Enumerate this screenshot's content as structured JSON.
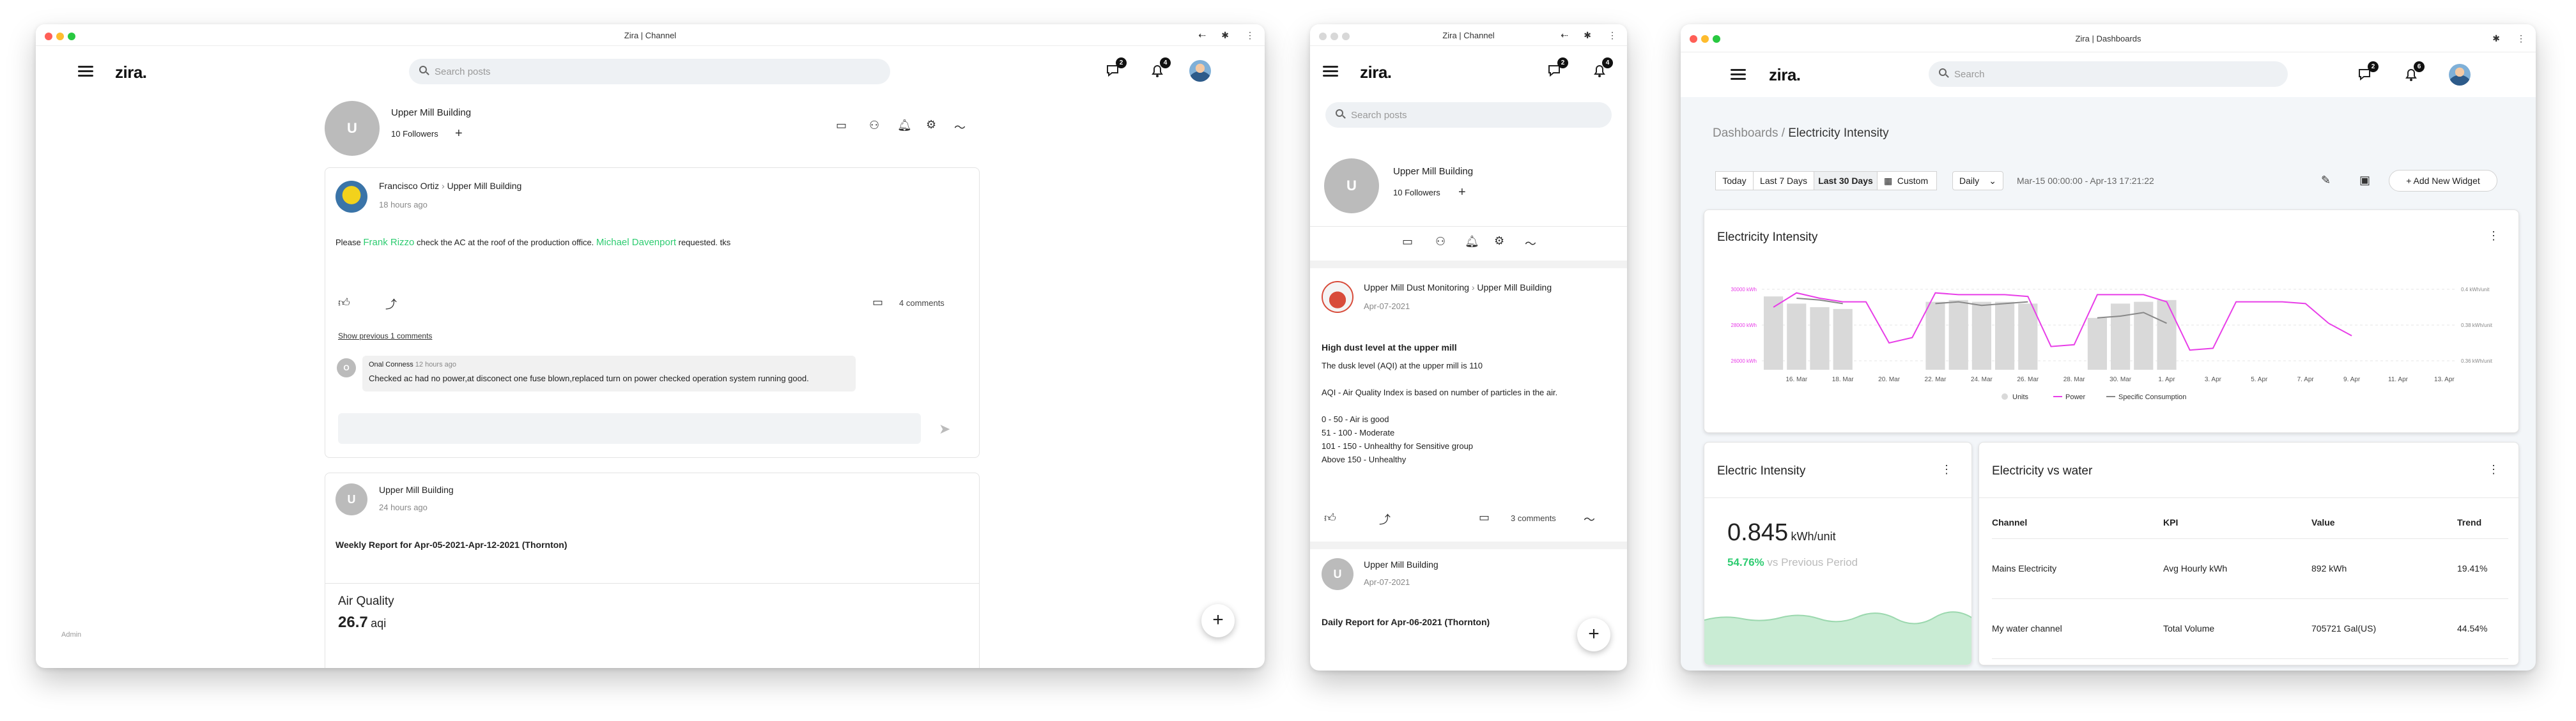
{
  "w1": {
    "title": "Zira | Channel",
    "logo": "zira.",
    "search_ph": "Search posts",
    "msg_count": "2",
    "notif_count": "4",
    "channel": {
      "initial": "U",
      "name": "Upper Mill Building",
      "followers": "10 Followers"
    },
    "post1": {
      "author": "Francisco Ortiz",
      "sep": "›",
      "channel": "Upper Mill Building",
      "time": "18 hours ago",
      "text_a": "Please",
      "mention1": "Frank Rizzo",
      "text_b": "check the AC at the roof of the production office.",
      "mention2": "Michael Davenport",
      "text_c": "requested. tks",
      "comments_count": "4 comments",
      "show_prev": "Show previous 1 comments",
      "comment": {
        "author": "Onal Conness",
        "time": "12 hours ago",
        "text": "Checked ac had no power,at disconect one fuse blown,replaced turn on power checked operation system running good."
      }
    },
    "post2": {
      "initial": "U",
      "author": "Upper Mill Building",
      "time": "24 hours ago",
      "text": "Weekly Report for Apr-05-2021-Apr-12-2021 (Thornton)",
      "metric_title": "Air Quality",
      "metric_value": "26.7",
      "metric_unit": "aqi"
    },
    "admin": "Admin",
    "fab": "+"
  },
  "w2": {
    "title": "Zira | Channel",
    "logo": "zira.",
    "search_ph": "Search posts",
    "msg_count": "2",
    "notif_count": "4",
    "channel": {
      "initial": "U",
      "name": "Upper Mill Building",
      "followers": "10 Followers"
    },
    "post1": {
      "author": "Upper Mill Dust Monitoring",
      "sep": "›",
      "channel": "Upper Mill Building",
      "time": "Apr-07-2021",
      "title": "High dust level at the upper mill",
      "lines": [
        "The dusk level (AQI) at the upper mill is 110",
        "",
        "AQI - Air Quality Index is based on number of particles in the air.",
        "",
        "0 - 50 - Air is good",
        "51 - 100 - Moderate",
        "101 - 150 - Unhealthy for Sensitive group",
        "Above 150 - Unhealthy"
      ],
      "comments_count": "3 comments"
    },
    "post2": {
      "initial": "U",
      "author": "Upper Mill Building",
      "time": "Apr-07-2021",
      "text": "Daily Report for Apr-06-2021 (Thornton)"
    },
    "fab": "+"
  },
  "w3": {
    "title": "Zira | Dashboards",
    "logo": "zira.",
    "search_ph": "Search",
    "msg_count": "2",
    "notif_count": "6",
    "breadcrumb": {
      "root": "Dashboards",
      "sep": "/",
      "current": "Electricity Intensity"
    },
    "ranges": [
      "Today",
      "Last 7 Days",
      "Last 30 Days",
      "Custom"
    ],
    "active_range": "Last 30 Days",
    "interval": "Daily",
    "date_range": "Mar-15 00:00:00 - Apr-13 17:21:22",
    "add_widget": "Add New Widget",
    "chart_card_title": "Electricity Intensity",
    "kpi": {
      "title": "Electric Intensity",
      "value": "0.845",
      "unit": "kWh/unit",
      "pct": "54.76%",
      "vs": "vs Previous Period"
    },
    "table": {
      "title": "Electricity vs water",
      "headers": [
        "Channel",
        "KPI",
        "Value",
        "Trend"
      ],
      "rows": [
        [
          "Mains Electricity",
          "Avg Hourly kWh",
          "892 kWh",
          "19.41%"
        ],
        [
          "My water channel",
          "Total Volume",
          "705721 Gal(US)",
          "44.54%"
        ]
      ]
    }
  },
  "chart_data": {
    "type": "bar",
    "title": "Electricity Intensity",
    "x": [
      "15. Mar",
      "16. Mar",
      "17. Mar",
      "18. Mar",
      "19. Mar",
      "20. Mar",
      "21. Mar",
      "22. Mar",
      "23. Mar",
      "24. Mar",
      "25. Mar",
      "26. Mar",
      "27. Mar",
      "28. Mar",
      "29. Mar",
      "30. Mar",
      "31. Mar",
      "1. Apr",
      "2. Apr",
      "3. Apr",
      "4. Apr",
      "5. Apr",
      "6. Apr",
      "7. Apr",
      "8. Apr",
      "9. Apr",
      "10. Apr",
      "11. Apr",
      "12. Apr",
      "13. Apr"
    ],
    "xticks": [
      "16. Mar",
      "18. Mar",
      "20. Mar",
      "22. Mar",
      "24. Mar",
      "26. Mar",
      "28. Mar",
      "30. Mar",
      "1. Apr",
      "3. Apr",
      "5. Apr",
      "7. Apr",
      "9. Apr",
      "11. Apr",
      "13. Apr"
    ],
    "y_left_ticks": [
      "30000 kWh",
      "28000 kWh",
      "26000 kWh"
    ],
    "y_right_ticks": [
      "0.4 kWh/unit",
      "0.38 kWh/unit",
      "0.36 kWh/unit"
    ],
    "ylim": [
      25500,
      30500
    ],
    "series": [
      {
        "name": "Units",
        "kind": "bar",
        "color": "#d9d9d9",
        "values": [
          29600,
          29200,
          29000,
          28900,
          null,
          null,
          null,
          29300,
          29400,
          29300,
          29300,
          29200,
          null,
          null,
          28400,
          29200,
          29300,
          29400,
          null,
          null,
          null,
          null,
          null,
          null,
          null,
          null,
          null,
          null,
          null,
          null
        ]
      },
      {
        "name": "Power",
        "kind": "line",
        "color": "#e83ee8",
        "values": [
          29000,
          29800,
          29500,
          29300,
          29300,
          27000,
          27300,
          29800,
          29700,
          29700,
          29700,
          29600,
          26800,
          26900,
          29700,
          29700,
          29700,
          29300,
          26600,
          26700,
          29300,
          29300,
          29300,
          29200,
          28100,
          27400,
          null,
          null,
          null,
          null
        ]
      },
      {
        "name": "Specific Consumption",
        "kind": "line",
        "color": "#888888",
        "values": [
          null,
          29500,
          29400,
          29200,
          null,
          null,
          null,
          29200,
          29300,
          29100,
          29200,
          29300,
          null,
          null,
          28400,
          28500,
          28700,
          28100,
          null,
          null,
          null,
          null,
          null,
          null,
          null,
          null,
          null,
          null,
          null,
          null
        ]
      }
    ],
    "legend": "bottom",
    "grid": true
  }
}
